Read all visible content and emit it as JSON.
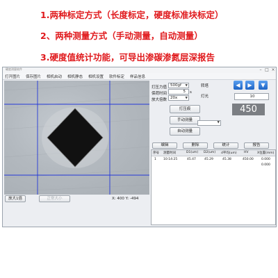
{
  "features": [
    "1.两种标定方式（长度标定，硬度标准块标定）",
    "2、两种测量方式（手动测量，自动测量）",
    "3.硬度值统计功能，可导出渗碳渗氮层深报告"
  ],
  "window": {
    "title": "硬度测量软件"
  },
  "menu": [
    "打开图片",
    "保存图片",
    "相机启动",
    "相机静态",
    "相机设置",
    "软件标定",
    "样品信息"
  ],
  "viewer": {
    "coords": "X: 400   Y: -494",
    "zoom_in_label": "放大1倍",
    "original_size_label": "正常大小"
  },
  "controls": {
    "load_label": "打压力值",
    "load_value": "500gf",
    "dwell_label": "保荷时间",
    "dwell_value": "5",
    "dwell_unit": "s",
    "magnification_label": "放大倍数",
    "magnification_value": "20x",
    "turret_label": "转塔",
    "light_label": "灯光",
    "light_value": "10",
    "indent_button": "打压痕",
    "manual_button": "手动测量",
    "auto_button": "自动测量",
    "hv_label": "HV",
    "hv_value": "450",
    "arrows": [
      "◀",
      "▶",
      "▼"
    ]
  },
  "table_buttons": [
    "编辑",
    "删除",
    "统计",
    "报告"
  ],
  "table": {
    "headers": [
      "序号",
      "测量时间",
      "D1(um)",
      "D2(um)",
      "d平均(um)",
      "HV",
      "X位置(mm)"
    ],
    "rows": [
      [
        "1",
        "10:14:25",
        "45.47",
        "45.29",
        "45.38",
        "450.00",
        "0.000"
      ],
      [
        "",
        "",
        "",
        "",
        "",
        "",
        "0.000"
      ]
    ]
  }
}
